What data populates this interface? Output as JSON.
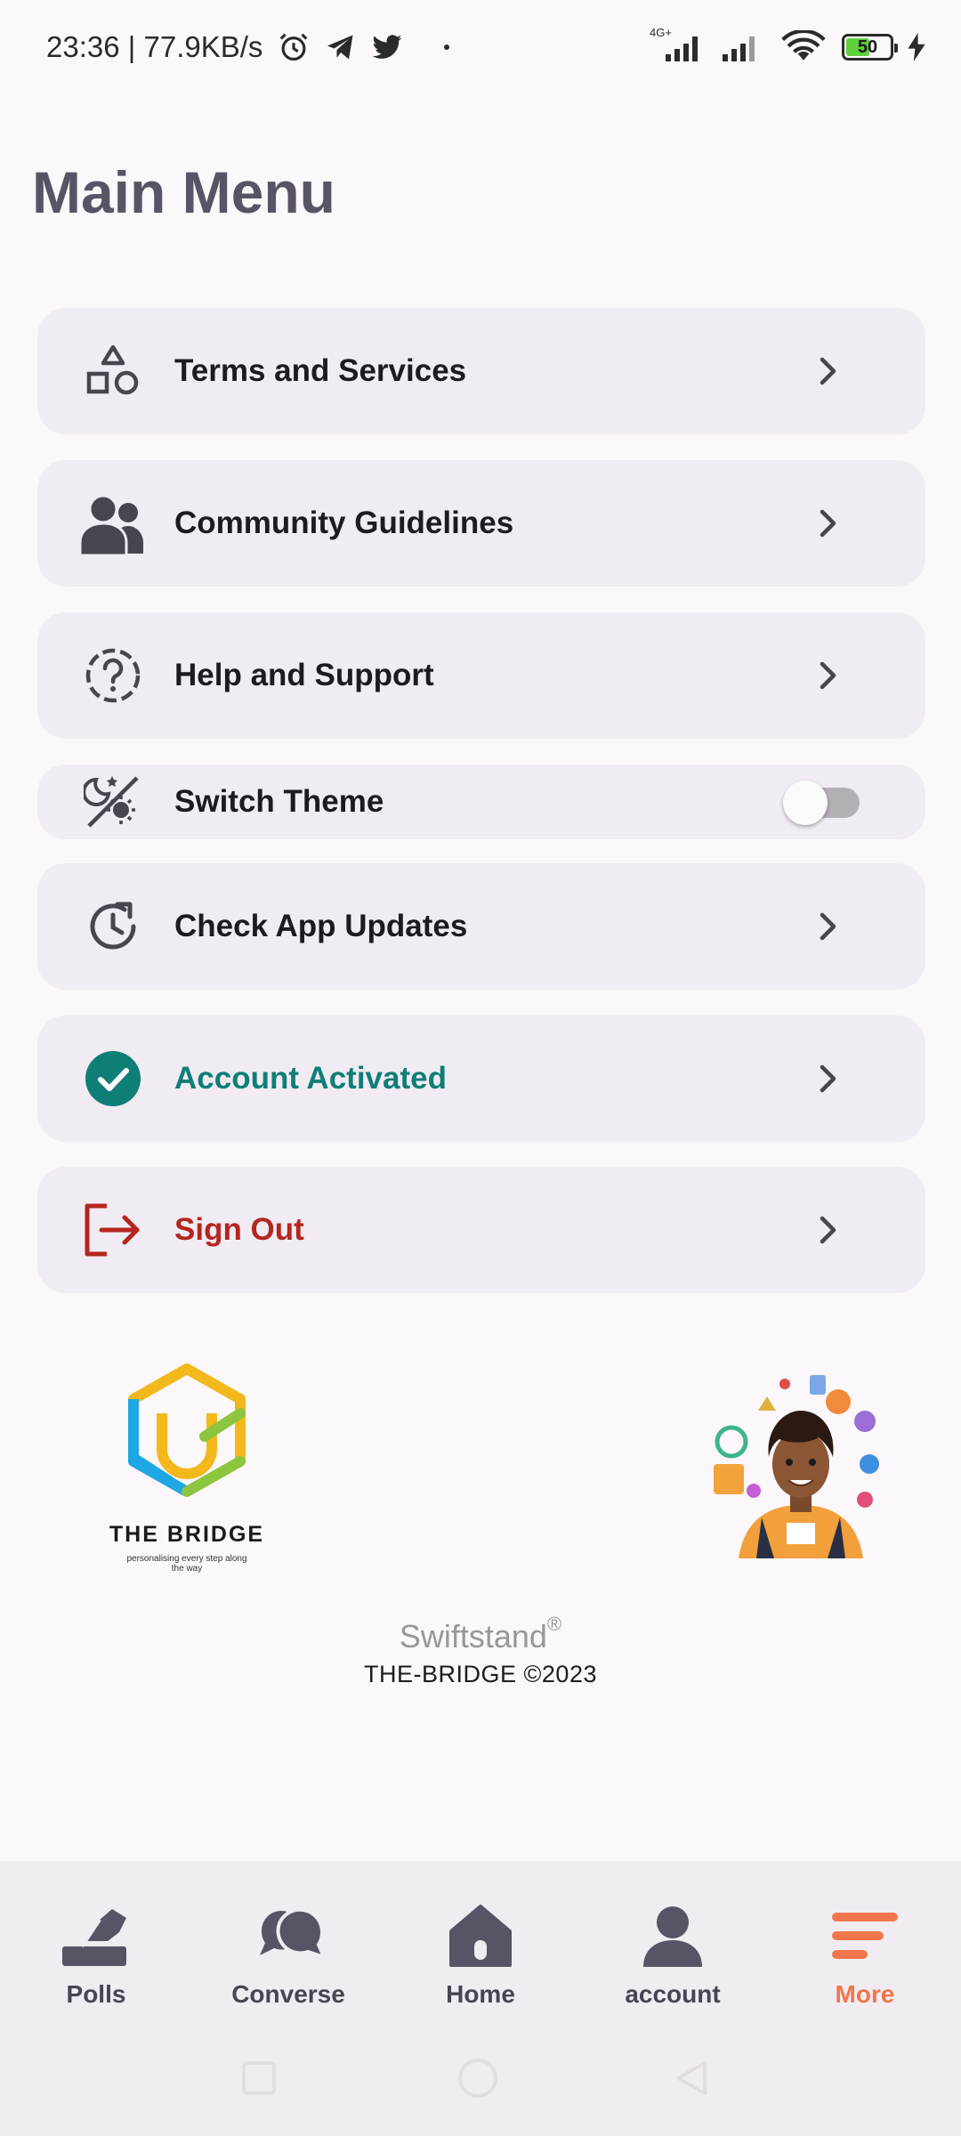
{
  "status_bar": {
    "time_speed": "23:36 | 77.9KB/s",
    "network": "4G+",
    "battery": "50"
  },
  "page": {
    "title": "Main Menu"
  },
  "menu": {
    "terms": "Terms and Services",
    "community": "Community Guidelines",
    "help": "Help and Support",
    "theme": "Switch Theme",
    "updates": "Check App Updates",
    "account": "Account Activated",
    "signout": "Sign Out"
  },
  "theme_toggle": {
    "on": false
  },
  "logo": {
    "title": "THE BRIDGE",
    "tagline": "personalising every step along the way"
  },
  "brand": {
    "name": "Swiftstand",
    "mark": "®",
    "copyright": "THE-BRIDGE ©2023"
  },
  "nav": {
    "polls": "Polls",
    "converse": "Converse",
    "home": "Home",
    "account": "account",
    "more": "More",
    "active": "More"
  },
  "colors": {
    "title": "#5a5366",
    "account_activated": "#0f7e77",
    "sign_out": "#b3261e",
    "nav_active": "#f2764b",
    "card_bg": "#f1ebf3"
  }
}
